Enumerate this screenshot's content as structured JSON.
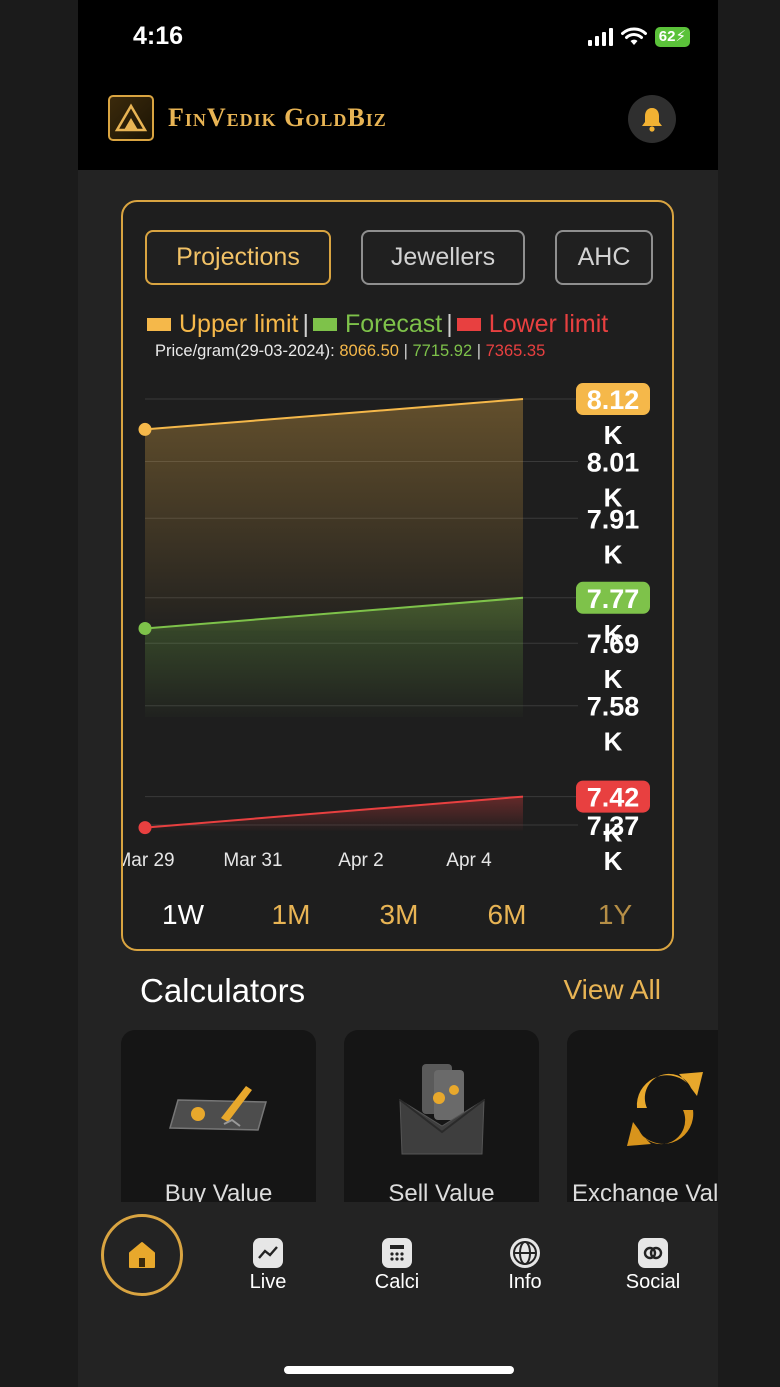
{
  "status_bar": {
    "time": "4:16",
    "battery": "62"
  },
  "header": {
    "brand": "FinVedik GoldBiz",
    "bell_icon": "bell-icon",
    "logo_icon": "goldbiz-logo"
  },
  "tabs": [
    {
      "label": "Projections",
      "active": true
    },
    {
      "label": "Jewellers",
      "active": false
    },
    {
      "label": "AHC",
      "active": false
    }
  ],
  "legend": {
    "upper": "Upper limit",
    "forecast": "Forecast",
    "lower": "Lower limit",
    "sep": "|",
    "price_label": "Price/gram(29-03-2024):",
    "upper_value": "8066.50",
    "forecast_value": "7715.92",
    "lower_value": "7365.35"
  },
  "colors": {
    "accent": "#e8b454",
    "upper": "#f5b84a",
    "forecast": "#7ec24a",
    "lower": "#e84040"
  },
  "chart_data": {
    "type": "area",
    "x": [
      "Mar 29",
      "Mar 31",
      "Apr 2",
      "Apr 4"
    ],
    "x_start": "2024-03-29",
    "x_end": "2024-04-05",
    "series": [
      {
        "name": "Upper limit",
        "color": "#f5b84a",
        "start": 8066.5,
        "end": 8120
      },
      {
        "name": "Forecast",
        "color": "#7ec24a",
        "start": 7715.92,
        "end": 7770
      },
      {
        "name": "Lower limit",
        "color": "#e84040",
        "start": 7365.35,
        "end": 7420
      }
    ],
    "y_ticks": [
      {
        "label": "8.12",
        "value": 8120,
        "badge": "#f5b84a",
        "badge_text": "#ffffff"
      },
      {
        "label": "8.01",
        "value": 8010
      },
      {
        "label": "7.91",
        "value": 7910
      },
      {
        "label": "7.77",
        "value": 7770,
        "badge": "#7ec24a",
        "badge_text": "#ffffff"
      },
      {
        "label": "7.69",
        "value": 7690
      },
      {
        "label": "7.58",
        "value": 7580
      },
      {
        "label": "7.42",
        "value": 7420,
        "badge": "#e84040",
        "badge_text": "#ffffff"
      },
      {
        "label": "7.37",
        "value": 7370
      }
    ],
    "y_suffix": "K",
    "ylim": [
      7340,
      8150
    ],
    "grid": true
  },
  "ranges": [
    {
      "label": "1W",
      "active": true
    },
    {
      "label": "1M",
      "active": false
    },
    {
      "label": "3M",
      "active": false
    },
    {
      "label": "6M",
      "active": false
    },
    {
      "label": "1Y",
      "active": false
    }
  ],
  "calculators": {
    "title": "Calculators",
    "view_all": "View All",
    "items": [
      {
        "label": "Buy Value",
        "icon": "gold-bar-icon"
      },
      {
        "label": "Sell Value",
        "icon": "cash-envelope-icon"
      },
      {
        "label": "Exchange Value",
        "icon": "exchange-arrows-icon"
      }
    ]
  },
  "bottom_nav": [
    {
      "label": "",
      "icon": "home-icon",
      "active": true
    },
    {
      "label": "Live",
      "icon": "chart-icon"
    },
    {
      "label": "Calci",
      "icon": "calculator-icon"
    },
    {
      "label": "Info",
      "icon": "globe-icon"
    },
    {
      "label": "Social",
      "icon": "link-icon"
    }
  ]
}
